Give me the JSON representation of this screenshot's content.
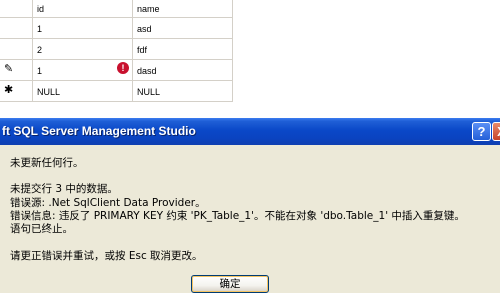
{
  "grid": {
    "columns": [
      "id",
      "name"
    ],
    "rows": [
      {
        "marker": "",
        "id": "1",
        "name": "asd",
        "error": false
      },
      {
        "marker": "",
        "id": "2",
        "name": "fdf",
        "error": false
      },
      {
        "marker": "✎",
        "id": "1",
        "name": "dasd",
        "error": true
      },
      {
        "marker": "✱",
        "id": "NULL",
        "name": "NULL",
        "error": false
      }
    ],
    "error_glyph": "!"
  },
  "dialog": {
    "title": "ft SQL Server Management Studio",
    "help_glyph": "?",
    "close_glyph": "X",
    "lines": [
      "未更新任何行。",
      "未提交行 3 中的数据。",
      "错误源: .Net SqlClient Data Provider。",
      "错误信息: 违反了 PRIMARY KEY 约束 'PK_Table_1'。不能在对象 'dbo.Table_1' 中插入重复键。",
      "语句已终止。",
      "请更正错误并重试，或按 Esc 取消更改。"
    ],
    "ok_label": "确定"
  },
  "colors": {
    "titlebar": "#0a48c8",
    "dialog_bg": "#ece9d8",
    "error_icon": "#c8102e"
  }
}
